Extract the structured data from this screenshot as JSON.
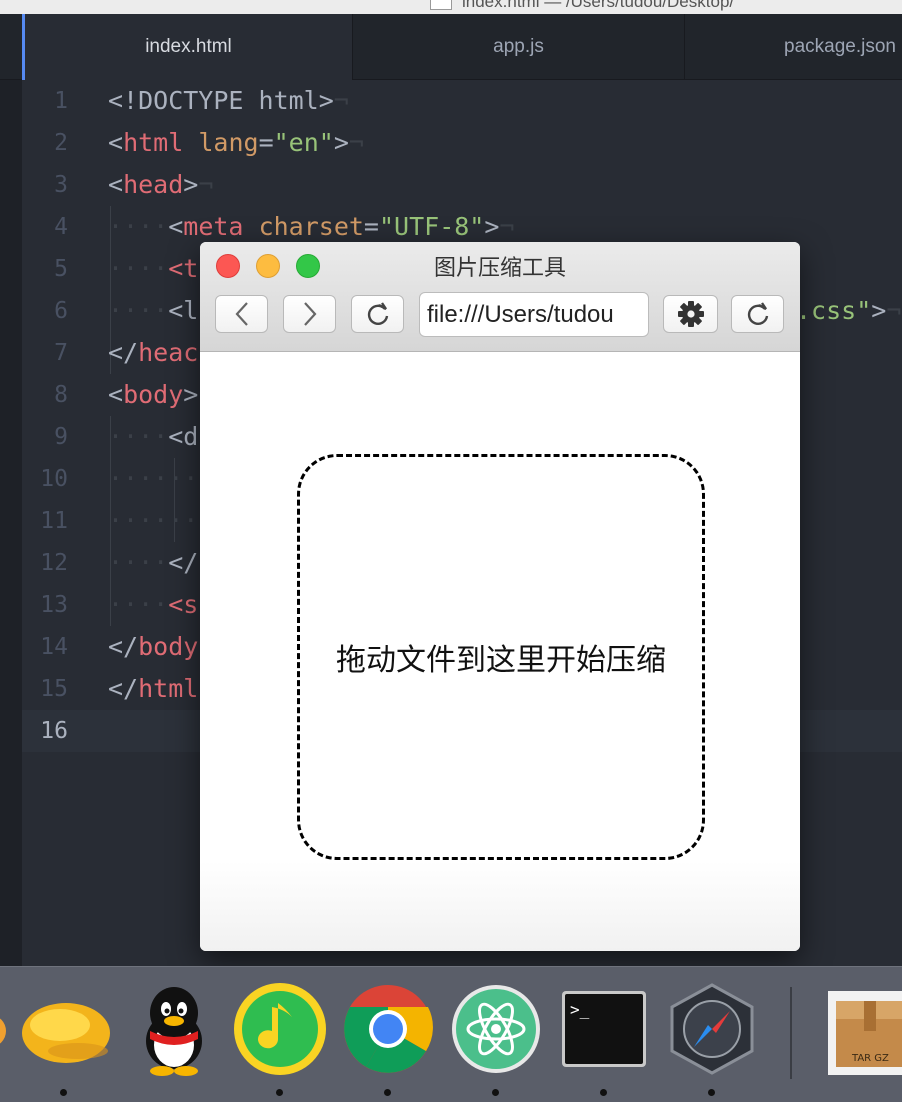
{
  "window": {
    "title": "index.html — /Users/tudou/Desktop/"
  },
  "tabs": [
    {
      "label": "index.html",
      "active": true
    },
    {
      "label": "app.js",
      "active": false
    },
    {
      "label": "package.json",
      "active": false
    }
  ],
  "editor": {
    "line_numbers": [
      "1",
      "2",
      "3",
      "4",
      "5",
      "6",
      "7",
      "8",
      "9",
      "10",
      "11",
      "12",
      "13",
      "14",
      "15",
      "16"
    ],
    "current_line": 16,
    "lines": {
      "l1": [
        "<!DOCTYPE html>",
        "¬"
      ],
      "l2": [
        "<",
        "html",
        " ",
        "lang",
        "=",
        "\"en\"",
        ">",
        "¬"
      ],
      "l3": [
        "<",
        "head",
        ">",
        "¬"
      ],
      "l4": [
        "····",
        "<",
        "meta",
        " ",
        "charset",
        "=",
        "\"UTF-8\"",
        ">",
        "¬"
      ],
      "l5": [
        "····",
        "<t"
      ],
      "l6": [
        "····",
        "<l",
        ".css\"",
        ">",
        "¬"
      ],
      "l7": [
        "</",
        "heac"
      ],
      "l8": [
        "<",
        "body",
        ">"
      ],
      "l9": [
        "····",
        "<d"
      ],
      "l10": [
        "········"
      ],
      "l11": [
        "········"
      ],
      "l12": [
        "····",
        "</"
      ],
      "l13": [
        "····",
        "<s"
      ],
      "l14": [
        "</",
        "body"
      ],
      "l15": [
        "</",
        "html"
      ]
    }
  },
  "browser": {
    "title": "图片压缩工具",
    "url": "file:///Users/tudou",
    "dropzone_text": "拖动文件到这里开始压缩"
  },
  "dock": {
    "items": [
      "mango-app-icon",
      "qq-icon",
      "qq-music-icon",
      "chrome-icon",
      "atom-icon",
      "terminal-icon",
      "safari-icon",
      "archive-targz-icon"
    ],
    "archive_label": "TAR GZ",
    "terminal_prompt": ">_"
  },
  "colors": {
    "tag": "#e06c75",
    "attribute": "#d19a66",
    "string": "#98c379",
    "accent": "#568af2"
  }
}
